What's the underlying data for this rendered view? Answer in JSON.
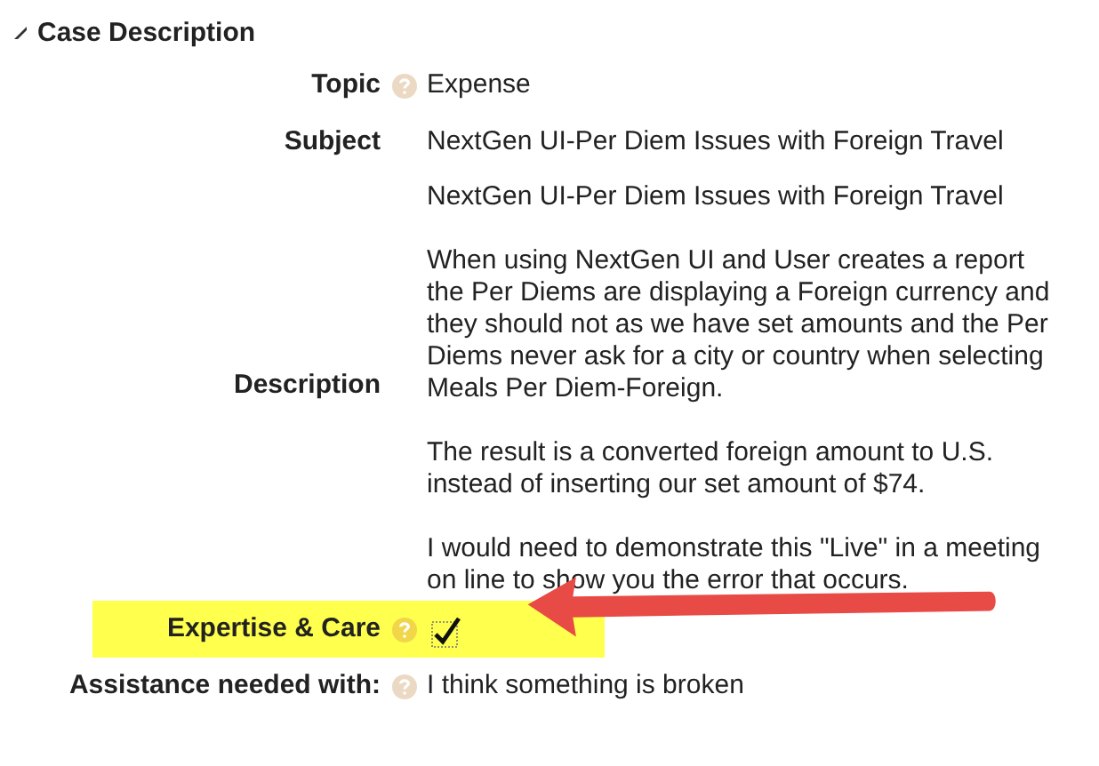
{
  "section": {
    "title": "Case Description",
    "expanded": true
  },
  "fields": [
    {
      "kind": "text",
      "label": "Topic",
      "help": true,
      "highlighted": false,
      "value": "Expense"
    },
    {
      "kind": "text",
      "label": "Subject",
      "help": false,
      "highlighted": false,
      "value": "NextGen UI-Per Diem Issues with Foreign Travel"
    },
    {
      "kind": "paragraphs",
      "label": "Description",
      "help": false,
      "highlighted": false,
      "paragraphs": [
        "NextGen UI-Per Diem Issues with Foreign Travel",
        "When using NextGen UI and User creates a report the Per Diems are displaying a Foreign currency and they should not as we have set amounts and the Per Diems never ask for a city or country when selecting Meals Per Diem-Foreign.",
        "The result is a converted foreign amount to U.S. instead of inserting our set amount of $74.",
        "I would need to demonstrate this \"Live\" in a meeting on line to show you the error that occurs."
      ]
    },
    {
      "kind": "checkbox",
      "label": "Expertise & Care",
      "help": true,
      "highlighted": true,
      "checked": true
    },
    {
      "kind": "text",
      "label": "Assistance needed with:",
      "help": true,
      "highlighted": false,
      "value": "I think something is broken"
    }
  ]
}
